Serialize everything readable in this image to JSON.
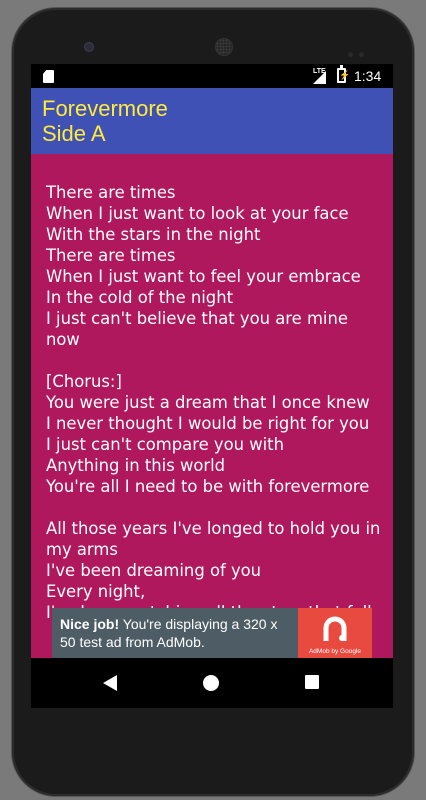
{
  "status_bar": {
    "network": "LTE",
    "time": "1:34"
  },
  "app_bar": {
    "title_line1": "Forevermore",
    "title_line2": "Side A"
  },
  "lyrics": "There are times\nWhen I just want to look at your face\nWith the stars in the night\nThere are times\nWhen I just want to feel your embrace\nIn the cold of the night\nI just can't believe that you are mine now\n\n[Chorus:]\nYou were just a dream that I once knew\nI never thought I would be right for you\nI just can't compare you with\nAnything in this world\nYou're all I need to be with forevermore\n\nAll those years I've longed to hold you in my arms\nI've been dreaming of you\nEvery night,\nI've been watching all the stars that fall",
  "ad": {
    "headline": "Nice job!",
    "body": " You're displaying a 320 x 50 test ad from AdMob.",
    "brand": "AdMob by Google"
  },
  "nav": {
    "back": "back-icon",
    "home": "home-icon",
    "recents": "recents-icon"
  },
  "colors": {
    "app_bar": "#3f51b5",
    "title": "#ffeb3b",
    "content_bg": "#b0185e",
    "ad_text_bg": "#4e5d65",
    "ad_logo_bg": "#e94a3f"
  }
}
